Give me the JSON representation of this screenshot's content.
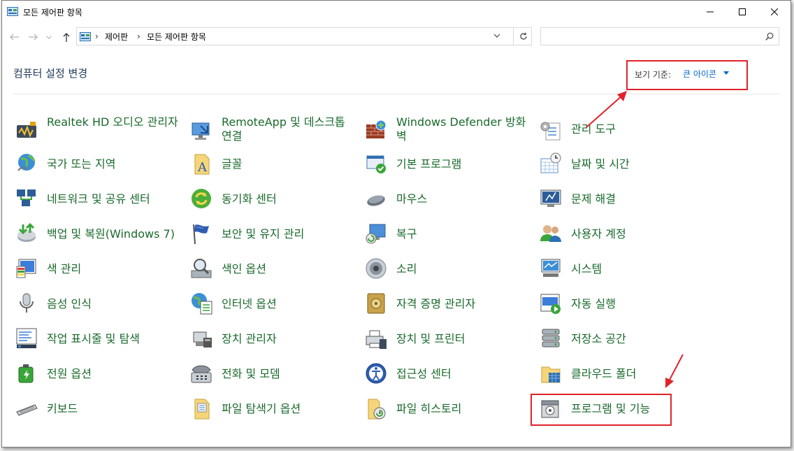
{
  "window": {
    "title": "모든 제어판 항목"
  },
  "address": {
    "crumbs": [
      "제어판",
      "모든 제어판 항목"
    ],
    "separator": "›"
  },
  "search": {
    "placeholder": ""
  },
  "heading": "컴퓨터 설정 변경",
  "view_by": {
    "label": "보기 기준:",
    "value": "큰 아이콘"
  },
  "items": [
    {
      "label": "Realtek HD 오디오 관리자",
      "icon": "audio-manager-icon"
    },
    {
      "label": "RemoteApp 및 데스크톱 연결",
      "icon": "remote-desktop-icon"
    },
    {
      "label": "Windows Defender 방화벽",
      "icon": "firewall-icon"
    },
    {
      "label": "관리 도구",
      "icon": "admin-tools-icon"
    },
    {
      "label": "국가 또는 지역",
      "icon": "globe-icon"
    },
    {
      "label": "글꼴",
      "icon": "font-icon"
    },
    {
      "label": "기본 프로그램",
      "icon": "default-programs-icon"
    },
    {
      "label": "날짜 및 시간",
      "icon": "calendar-clock-icon"
    },
    {
      "label": "네트워크 및 공유 센터",
      "icon": "network-icon"
    },
    {
      "label": "동기화 센터",
      "icon": "sync-icon"
    },
    {
      "label": "마우스",
      "icon": "mouse-icon"
    },
    {
      "label": "문제 해결",
      "icon": "troubleshoot-icon"
    },
    {
      "label": "백업 및 복원(Windows 7)",
      "icon": "backup-icon"
    },
    {
      "label": "보안 및 유지 관리",
      "icon": "flag-icon"
    },
    {
      "label": "복구",
      "icon": "recovery-icon"
    },
    {
      "label": "사용자 계정",
      "icon": "users-icon"
    },
    {
      "label": "색 관리",
      "icon": "color-management-icon"
    },
    {
      "label": "색인 옵션",
      "icon": "indexing-icon"
    },
    {
      "label": "소리",
      "icon": "speaker-icon"
    },
    {
      "label": "시스템",
      "icon": "system-icon"
    },
    {
      "label": "음성 인식",
      "icon": "microphone-icon"
    },
    {
      "label": "인터넷 옵션",
      "icon": "internet-options-icon"
    },
    {
      "label": "자격 증명 관리자",
      "icon": "credential-vault-icon"
    },
    {
      "label": "자동 실행",
      "icon": "autoplay-icon"
    },
    {
      "label": "작업 표시줄 및 탐색",
      "icon": "taskbar-icon"
    },
    {
      "label": "장치 관리자",
      "icon": "device-manager-icon"
    },
    {
      "label": "장치 및 프린터",
      "icon": "printer-icon"
    },
    {
      "label": "저장소 공간",
      "icon": "storage-icon"
    },
    {
      "label": "전원 옵션",
      "icon": "power-icon"
    },
    {
      "label": "전화 및 모뎀",
      "icon": "phone-icon"
    },
    {
      "label": "접근성 센터",
      "icon": "accessibility-icon"
    },
    {
      "label": "클라우드 폴더",
      "icon": "cloud-folder-icon"
    },
    {
      "label": "키보드",
      "icon": "keyboard-icon"
    },
    {
      "label": "파일 탐색기 옵션",
      "icon": "folder-options-icon"
    },
    {
      "label": "파일 히스토리",
      "icon": "file-history-icon"
    },
    {
      "label": "프로그램 및 기능",
      "icon": "programs-features-icon"
    }
  ],
  "colors": {
    "accent_link": "#0066cc",
    "item_text": "#1a6a2c",
    "highlight": "#e0232a"
  }
}
